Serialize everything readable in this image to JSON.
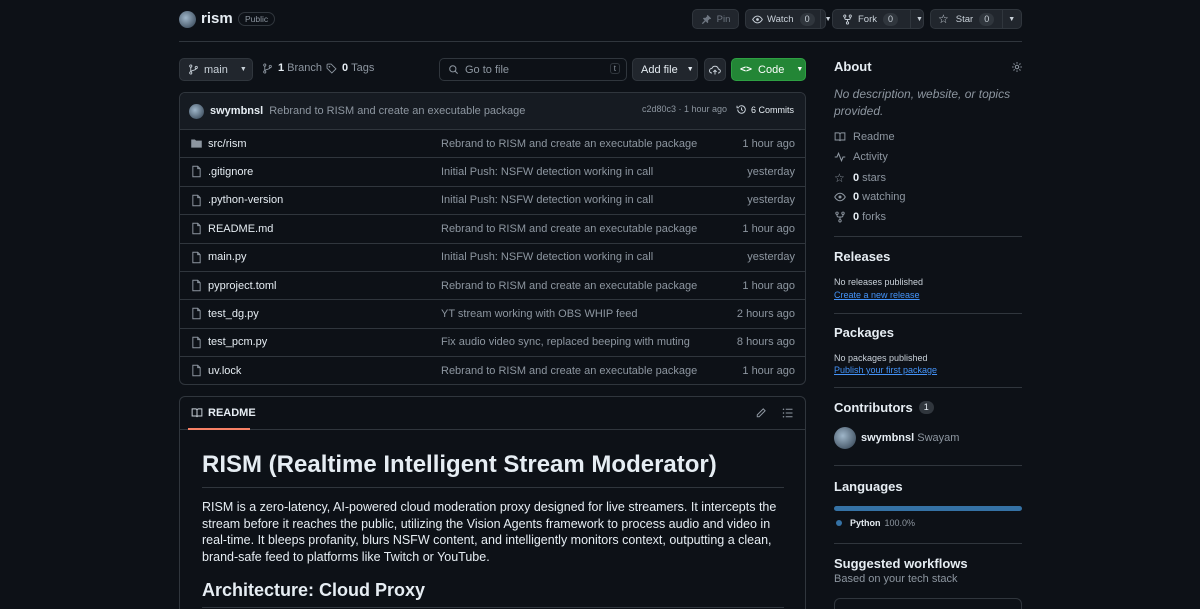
{
  "repo": {
    "name": "rism",
    "visibility": "Public"
  },
  "actions": {
    "pin": "Pin",
    "watch": "Watch",
    "watch_count": "0",
    "fork": "Fork",
    "fork_count": "0",
    "star": "Star",
    "star_count": "0"
  },
  "toolbar": {
    "branch": "main",
    "branches_count": "1",
    "branches_label": "Branch",
    "tags_count": "0",
    "tags_label": "Tags",
    "goto_placeholder": "Go to file",
    "goto_shortcut": "t",
    "add_file": "Add file",
    "code": "Code"
  },
  "latest_commit": {
    "author": "swymbnsl",
    "message": "Rebrand to RISM and create an executable package",
    "hash_time": "c2d80c3 · 1 hour ago",
    "commits": "6 Commits"
  },
  "files": [
    {
      "name": "src/rism",
      "type": "folder",
      "message": "Rebrand to RISM and create an executable package",
      "time": "1 hour ago"
    },
    {
      "name": ".gitignore",
      "type": "file",
      "message": "Initial Push: NSFW detection working in call",
      "time": "yesterday"
    },
    {
      "name": ".python-version",
      "type": "file",
      "message": "Initial Push: NSFW detection working in call",
      "time": "yesterday"
    },
    {
      "name": "README.md",
      "type": "file",
      "message": "Rebrand to RISM and create an executable package",
      "time": "1 hour ago"
    },
    {
      "name": "main.py",
      "type": "file",
      "message": "Initial Push: NSFW detection working in call",
      "time": "yesterday"
    },
    {
      "name": "pyproject.toml",
      "type": "file",
      "message": "Rebrand to RISM and create an executable package",
      "time": "1 hour ago"
    },
    {
      "name": "test_dg.py",
      "type": "file",
      "message": "YT stream working with OBS WHIP feed",
      "time": "2 hours ago"
    },
    {
      "name": "test_pcm.py",
      "type": "file",
      "message": "Fix audio video sync, replaced beeping with muting",
      "time": "8 hours ago"
    },
    {
      "name": "uv.lock",
      "type": "file",
      "message": "Rebrand to RISM and create an executable package",
      "time": "1 hour ago"
    }
  ],
  "readme": {
    "tab": "README",
    "title": "RISM (Realtime Intelligent Stream Moderator)",
    "paragraph": "RISM is a zero-latency, AI-powered cloud moderation proxy designed for live streamers. It intercepts the stream before it reaches the public, utilizing the Vision Agents framework to process audio and video in real-time. It bleeps profanity, blurs NSFW content, and intelligently monitors context, outputting a clean, brand-safe feed to platforms like Twitch or YouTube.",
    "h2": "Architecture: Cloud Proxy"
  },
  "about": {
    "title": "About",
    "description": "No description, website, or topics provided.",
    "readme": "Readme",
    "activity": "Activity",
    "stars_count": "0",
    "stars_label": "stars",
    "watching_count": "0",
    "watching_label": "watching",
    "forks_count": "0",
    "forks_label": "forks"
  },
  "releases": {
    "title": "Releases",
    "none": "No releases published",
    "create": "Create a new release"
  },
  "packages": {
    "title": "Packages",
    "none": "No packages published",
    "publish": "Publish your first package"
  },
  "contributors": {
    "title": "Contributors",
    "count": "1",
    "user": "swymbnsl",
    "fullname": "Swayam"
  },
  "languages": {
    "title": "Languages",
    "items": [
      {
        "name": "Python",
        "percent": "100.0%",
        "color": "#3572A5",
        "share": 1.0
      }
    ]
  },
  "workflows": {
    "title": "Suggested workflows",
    "subtitle": "Based on your tech stack"
  },
  "colors": {
    "accent_green": "#238636",
    "link_blue": "#4493f8",
    "border": "#30363d"
  }
}
